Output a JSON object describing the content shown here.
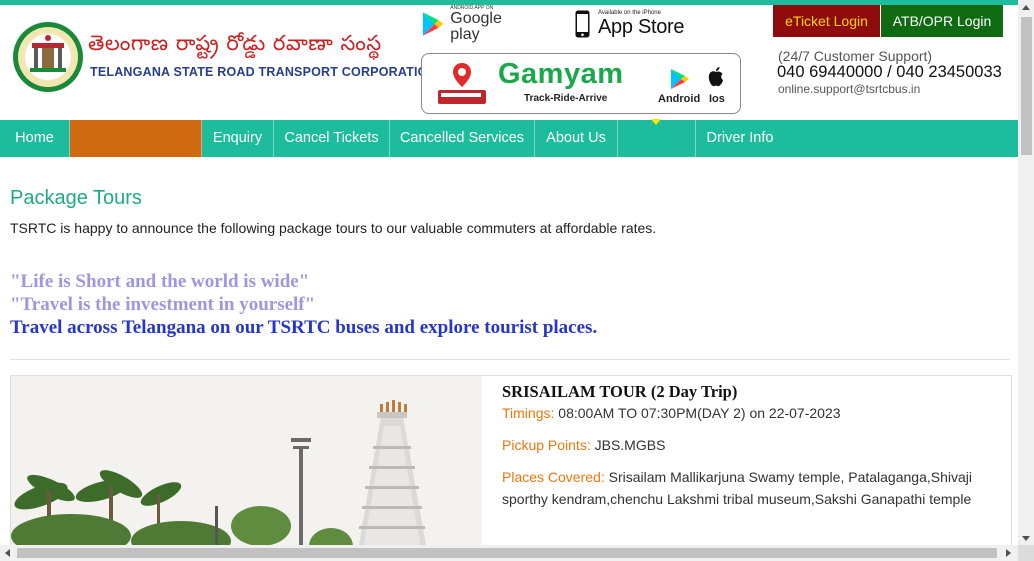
{
  "header": {
    "brand_telugu": "తెలంగాణ రాష్ట్ర రోడ్డు రవాణా సంస్థ",
    "brand_english": "TELANGANA STATE ROAD TRANSPORT CORPORATION",
    "google_play_small": "ANDROID APP ON",
    "google_play_label": "Google play",
    "app_store_small": "Available on the iPhone",
    "app_store_label": "App Store",
    "gamyam": {
      "title": "Gamyam",
      "tagline": "Track-Ride-Arrive",
      "android_label": "Android",
      "ios_label": "Ios"
    },
    "eticket_login": "eTicket Login",
    "atb_login": "ATB/OPR Login",
    "support_label": "(24/7 Customer Support)",
    "support_phones": "040 69440000 / 040 23450033",
    "support_email": "online.support@tsrtcbus.in"
  },
  "nav": {
    "items": [
      "Home",
      "",
      "Enquiry",
      "Cancel Tickets",
      "Cancelled Services",
      "About Us",
      "",
      "Driver Info"
    ]
  },
  "main": {
    "page_title": "Package Tours",
    "intro": "TSRTC is happy to announce the following package tours to our valuable commuters at affordable rates.",
    "quote1": "\"Life is Short and the world is wide\"",
    "quote2": "\"Travel is the investment in yourself\"",
    "quote3": "Travel across Telangana on our TSRTC buses and explore tourist places.",
    "tour": {
      "title": "SRISAILAM TOUR (2 Day Trip)",
      "timings_label": "Timings:",
      "timings_value": "08:00AM TO 07:30PM(DAY 2) on 22-07-2023",
      "pickup_label": "Pickup Points:",
      "pickup_value": "JBS.MGBS",
      "places_label": "Places Covered:",
      "places_value": "Srisailam Mallikarjuna Swamy temple, Patalaganga,Shivaji sporthy kendram,chenchu Lakshmi tribal museum,Sakshi Ganapathi temple"
    }
  },
  "colors": {
    "accent": "#1cbc9c",
    "nav_active": "#cf6a12",
    "eticket_bg": "#8e0b0e",
    "atb_bg": "#0f6a12",
    "label_orange": "#e8780c",
    "quote_light": "#9c97e0",
    "quote_dark": "#2636cc"
  }
}
